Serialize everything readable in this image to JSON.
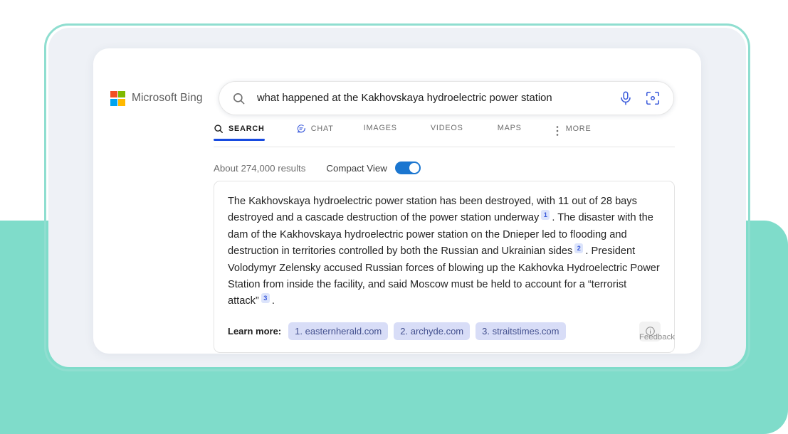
{
  "brand": {
    "name": "Microsoft Bing",
    "logo_icon": "microsoft-logo"
  },
  "search": {
    "query": "what happened at the Kakhovskaya hydroelectric power station",
    "placeholder": "Search the web",
    "search_icon": "search-icon",
    "mic_icon": "microphone-icon",
    "visual_search_icon": "camera-visual-search-icon"
  },
  "nav": {
    "tabs": [
      {
        "label": "SEARCH",
        "icon": "search-icon",
        "active": true
      },
      {
        "label": "CHAT",
        "icon": "chat-bubble-icon",
        "active": false
      },
      {
        "label": "IMAGES",
        "icon": "",
        "active": false
      },
      {
        "label": "VIDEOS",
        "icon": "",
        "active": false
      },
      {
        "label": "MAPS",
        "icon": "",
        "active": false
      },
      {
        "label": "MORE",
        "icon": "kebab-menu-icon",
        "active": false
      }
    ]
  },
  "meta": {
    "results_count": "About 274,000 results",
    "compact_view_label": "Compact View",
    "compact_view_on": true
  },
  "answer": {
    "part1": "The Kakhovskaya hydroelectric power station has been destroyed, with 11 out of 28 bays destroyed and a cascade destruction of the power station underway",
    "cite1": "1",
    "part2": ". The disaster with the dam of the Kakhovskaya hydroelectric power station on the Dnieper led to flooding and destruction in territories controlled by both the Russian and Ukrainian sides",
    "cite2": "2",
    "part3": ". President Volodymyr Zelensky accused Russian forces of blowing up the Kakhovka Hydroelectric Power Station from inside the facility, and said Moscow must be held to account for a “terrorist attack”",
    "cite3": "3",
    "part4": ".",
    "learn_more_label": "Learn more:",
    "sources": [
      "1. easternherald.com",
      "2. archyde.com",
      "3. straitstimes.com"
    ],
    "info_icon": "info-circle-icon"
  },
  "feedback": {
    "label": "Feedback"
  },
  "colors": {
    "accent_blue": "#3b5bdb",
    "active_underline": "#174ae0",
    "toggle_on": "#1b76d0",
    "mint_solid": "#7fdcca",
    "mint_outline": "#8fded0",
    "panel_bg": "#eef1f6",
    "chip_bg": "#d8ddf7",
    "chip_text": "#44518f"
  }
}
